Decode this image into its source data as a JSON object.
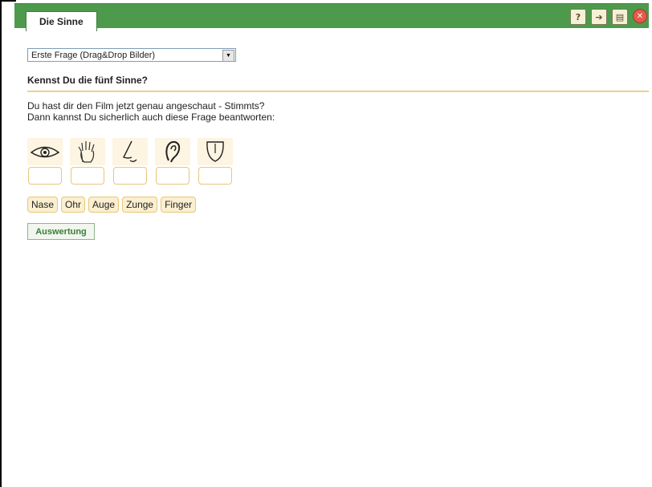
{
  "header": {
    "tab_label": "Die Sinne",
    "tools": [
      {
        "name": "help-icon",
        "glyph": "?"
      },
      {
        "name": "forward-icon",
        "glyph": "➔"
      },
      {
        "name": "print-icon",
        "glyph": "▤"
      },
      {
        "name": "close-icon",
        "glyph": "✕"
      }
    ]
  },
  "select": {
    "value": "Erste Frage (Drag&Drop Bilder)"
  },
  "question": {
    "title": "Kennst Du die fünf Sinne?",
    "line1": "Du hast dir den Film jetzt genau angeschaut - Stimmts?",
    "line2": "Dann kannst Du sicherlich auch diese Frage beantworten:"
  },
  "images": [
    "eye-icon",
    "hand-icon",
    "nose-icon",
    "ear-icon",
    "tongue-icon"
  ],
  "words": [
    "Nase",
    "Ohr",
    "Auge",
    "Zunge",
    "Finger"
  ],
  "evaluate_button": "Auswertung",
  "colors": {
    "header_green": "#4e9a4c",
    "accent_gold": "#e1c46a",
    "word_bg": "#fbefd0"
  }
}
